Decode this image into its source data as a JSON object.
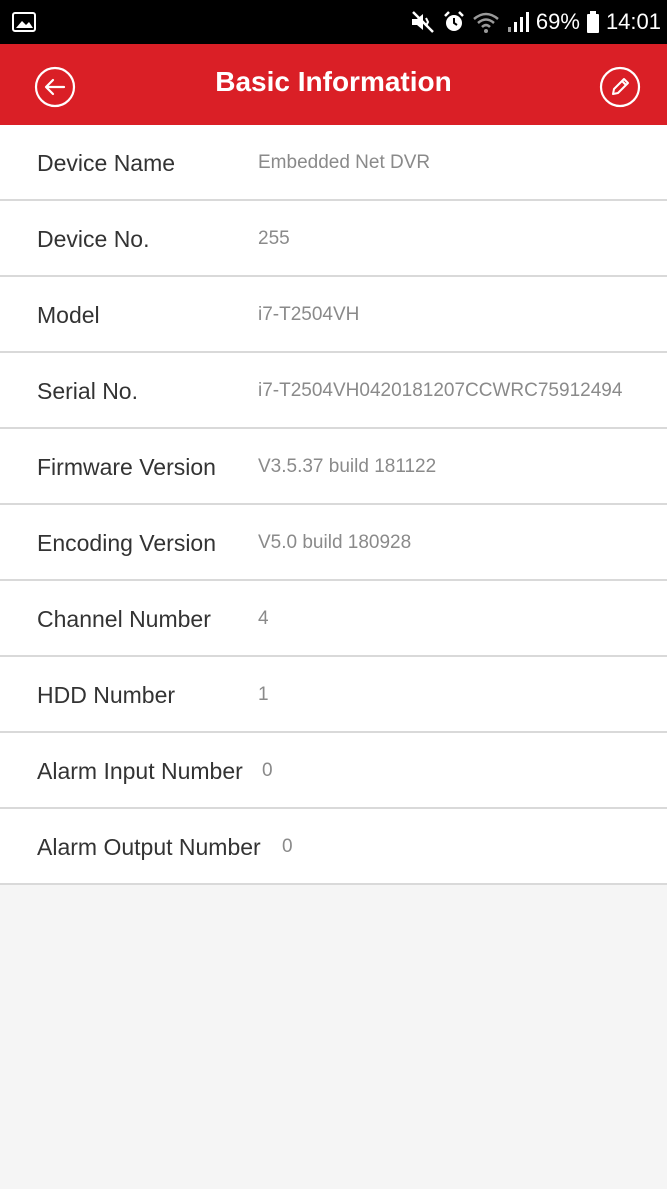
{
  "status_bar": {
    "battery_percent": "69%",
    "time": "14:01",
    "left_icon": "image-icon",
    "right_icons": [
      "mute-icon",
      "alarm-icon",
      "wifi-icon",
      "signal-icon",
      "battery-icon"
    ]
  },
  "app_bar": {
    "title": "Basic Information",
    "background_color": "#da1f26",
    "back_icon": "back-arrow-icon",
    "edit_icon": "pencil-icon"
  },
  "info_rows": [
    {
      "label": "Device Name",
      "value": "Embedded Net DVR"
    },
    {
      "label": "Device No.",
      "value": "255"
    },
    {
      "label": "Model",
      "value": "i7-T2504VH"
    },
    {
      "label": "Serial No.",
      "value": "i7-T2504VH0420181207CCWRC75912494"
    },
    {
      "label": "Firmware Version",
      "value": "V3.5.37 build 181122"
    },
    {
      "label": "Encoding Version",
      "value": "V5.0 build 180928"
    },
    {
      "label": "Channel Number",
      "value": "4"
    },
    {
      "label": "HDD Number",
      "value": "1"
    },
    {
      "label": "Alarm Input Number",
      "value": "0"
    },
    {
      "label": "Alarm Output Number",
      "value": "0"
    }
  ]
}
